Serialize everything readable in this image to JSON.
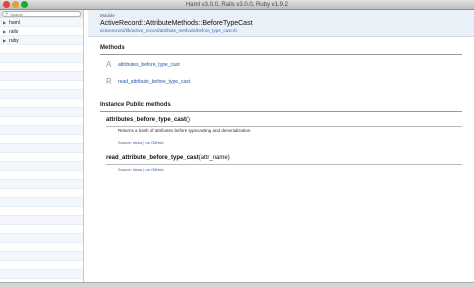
{
  "window": {
    "title": "Haml v3.0.0, Rails v3.0.0, Ruby v1.9.2"
  },
  "sidebar": {
    "search_placeholder": "Search",
    "items": [
      {
        "label": "haml"
      },
      {
        "label": "rails"
      },
      {
        "label": "ruby"
      }
    ]
  },
  "banner": {
    "kind": "Module",
    "name": "ActiveRecord::AttributeMethods::BeforeTypeCast",
    "file": "activerecord/lib/active_record/attribute_methods/before_type_cast.rb"
  },
  "methods_section": {
    "title": "Methods",
    "items": [
      {
        "letter": "A",
        "label": "attributes_before_type_cast"
      },
      {
        "letter": "R",
        "label": "read_attribute_before_type_cast"
      }
    ]
  },
  "instance_section": {
    "title": "Instance Public methods",
    "methods": [
      {
        "name": "attributes_before_type_cast",
        "args": "()",
        "description": "Returns a hash of attributes before typecasting and deserialization.",
        "source_label": "Source:",
        "show_label": "show",
        "github_label": "on GitHub"
      },
      {
        "name": "read_attribute_before_type_cast",
        "args": "(attr_name)",
        "description": "",
        "source_label": "Source:",
        "show_label": "show",
        "github_label": "on GitHub"
      }
    ]
  }
}
